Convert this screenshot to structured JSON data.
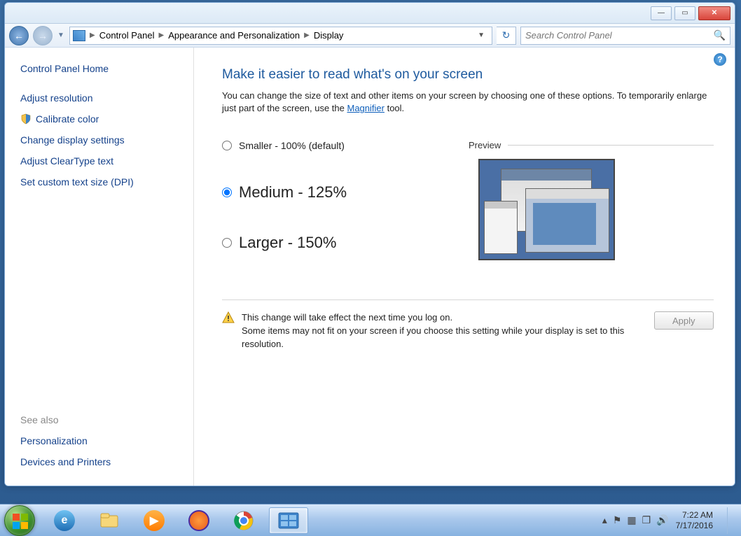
{
  "breadcrumb": {
    "items": [
      "Control Panel",
      "Appearance and Personalization",
      "Display"
    ]
  },
  "search": {
    "placeholder": "Search Control Panel"
  },
  "sidebar": {
    "home": "Control Panel Home",
    "links": [
      "Adjust resolution",
      "Calibrate color",
      "Change display settings",
      "Adjust ClearType text",
      "Set custom text size (DPI)"
    ],
    "see_also_label": "See also",
    "see_also": [
      "Personalization",
      "Devices and Printers"
    ]
  },
  "main": {
    "title": "Make it easier to read what's on your screen",
    "desc_before": "You can change the size of text and other items on your screen by choosing one of these options. To temporarily enlarge just part of the screen, use the ",
    "desc_link": "Magnifier",
    "desc_after": " tool.",
    "options": [
      {
        "label": "Smaller - 100% (default)",
        "checked": false
      },
      {
        "label": "Medium - 125%",
        "checked": true
      },
      {
        "label": "Larger - 150%",
        "checked": false
      }
    ],
    "preview_label": "Preview",
    "warning_line1": "This change will take effect the next time you log on.",
    "warning_line2": "Some items may not fit on your screen if you choose this setting while your display is set to this resolution.",
    "apply": "Apply"
  },
  "taskbar": {
    "time": "7:22 AM",
    "date": "7/17/2016"
  }
}
